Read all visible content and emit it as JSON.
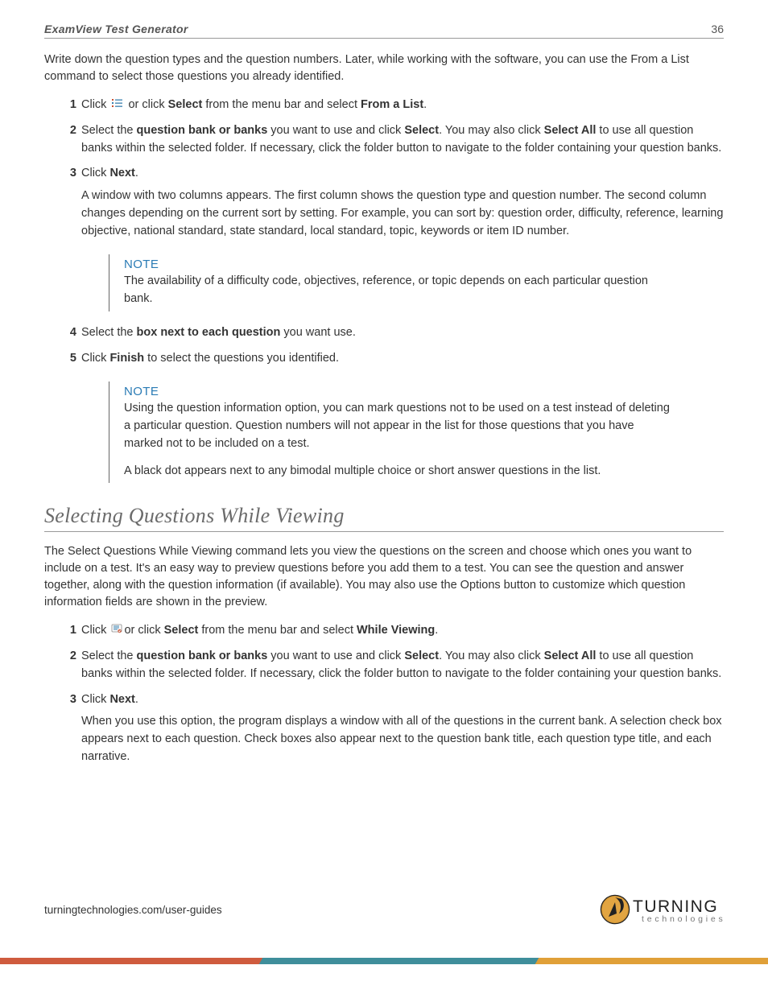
{
  "header": {
    "title": "ExamView Test Generator",
    "page": "36"
  },
  "intro": "Write down the question types and the question numbers. Later, while working with the software, you can use the From a List command to select those questions you already identified.",
  "listA": {
    "n1": "1",
    "s1a": "Click ",
    "s1b": " or click ",
    "s1_select": "Select",
    "s1c": " from the menu bar and select ",
    "s1_from": "From a List",
    "s1d": ".",
    "n2": "2",
    "s2a": "Select the ",
    "s2_qb": "question bank or banks",
    "s2b": " you want to use and click ",
    "s2_sel": "Select",
    "s2c": ". You may also click ",
    "s2_selall": "Select All",
    "s2d": " to use all question banks within the selected folder. If necessary, click the folder button to navigate to the folder containing your question banks.",
    "n3": "3",
    "s3a": "Click ",
    "s3_next": "Next",
    "s3b": ".",
    "s3_after": "A window with two columns appears. The first column shows the question type and question number. The second column changes depending on the current sort by setting. For example, you can sort by: question order, difficulty, reference, learning objective, national standard, state standard, local standard, topic, keywords or item ID number.",
    "n4": "4",
    "s4a": "Select the ",
    "s4_box": "box next to each question",
    "s4b": " you want use.",
    "n5": "5",
    "s5a": "Click ",
    "s5_fin": "Finish",
    "s5b": " to select the questions you identified."
  },
  "note1": {
    "title": "NOTE",
    "body": "The availability of a difficulty code, objectives, reference, or topic depends on each particular question bank."
  },
  "note2": {
    "title": "NOTE",
    "body1": "Using the question information option, you can mark questions not to be used on a test instead of deleting a particular question. Question numbers will not appear in the list for those questions that you have marked not to be included on a test.",
    "body2": "A black dot appears next to any bimodal multiple choice or short answer questions in the list."
  },
  "section2": {
    "heading": "Selecting Questions While Viewing",
    "intro": "The Select Questions While Viewing command lets you view the questions on the screen and choose which ones you want to include on a test. It's an easy way to preview questions before you add them to a test. You can see the question and answer together, along with the question information (if available). You may also use the Options button to customize which question information fields are shown in the preview."
  },
  "listB": {
    "n1": "1",
    "s1a": "Click ",
    "s1b": "or click ",
    "s1_select": "Select",
    "s1c": " from the menu bar and select ",
    "s1_wv": "While Viewing",
    "s1d": ".",
    "n2": "2",
    "s2a": "Select the ",
    "s2_qb": "question bank or banks",
    "s2b": " you want to use and click ",
    "s2_sel": "Select",
    "s2c": ". You may also click ",
    "s2_selall": "Select All",
    "s2d": " to use all question banks within the selected folder. If necessary, click the folder button to navigate to the folder containing your question banks.",
    "n3": "3",
    "s3a": "Click ",
    "s3_next": "Next",
    "s3b": ".",
    "s3_after": "When you use this option, the program displays a window with all of the questions in the current bank. A selection check box appears next to each question. Check boxes also appear next to the question bank title, each question type title, and each narrative."
  },
  "footer": {
    "url": "turningtechnologies.com/user-guides"
  },
  "logo": {
    "line1": "TURNING",
    "line2": "technologies"
  }
}
